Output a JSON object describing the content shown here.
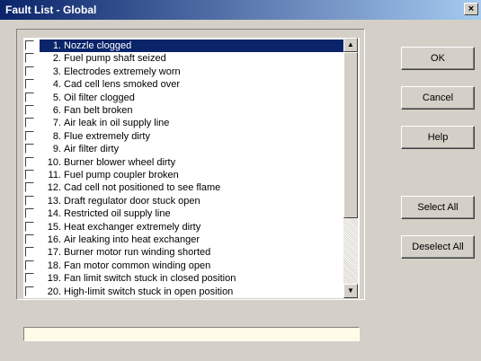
{
  "window": {
    "title": "Fault List - Global",
    "close_label": "×"
  },
  "faults": [
    {
      "num": "1.",
      "label": "Nozzle clogged",
      "selected": true
    },
    {
      "num": "2.",
      "label": "Fuel pump shaft seized"
    },
    {
      "num": "3.",
      "label": "Electrodes extremely worn"
    },
    {
      "num": "4.",
      "label": "Cad cell lens smoked over"
    },
    {
      "num": "5.",
      "label": "Oil filter clogged"
    },
    {
      "num": "6.",
      "label": "Fan belt broken"
    },
    {
      "num": "7.",
      "label": "Air leak in oil supply line"
    },
    {
      "num": "8.",
      "label": "Flue extremely dirty"
    },
    {
      "num": "9.",
      "label": "Air filter dirty"
    },
    {
      "num": "10.",
      "label": "Burner blower wheel dirty"
    },
    {
      "num": "11.",
      "label": "Fuel pump coupler broken"
    },
    {
      "num": "12.",
      "label": "Cad cell not positioned to see flame"
    },
    {
      "num": "13.",
      "label": "Draft regulator door stuck open"
    },
    {
      "num": "14.",
      "label": "Restricted oil supply line"
    },
    {
      "num": "15.",
      "label": "Heat exchanger extremely dirty"
    },
    {
      "num": "16.",
      "label": "Air leaking into heat exchanger"
    },
    {
      "num": "17.",
      "label": "Burner motor run winding shorted"
    },
    {
      "num": "18.",
      "label": "Fan motor common winding open"
    },
    {
      "num": "19.",
      "label": "Fan limit switch stuck in closed position"
    },
    {
      "num": "20.",
      "label": "High-limit switch stuck in open position"
    }
  ],
  "buttons": {
    "ok": "OK",
    "cancel": "Cancel",
    "help": "Help",
    "select_all": "Select All",
    "deselect_all": "Deselect All"
  },
  "status": {
    "text": ""
  },
  "scroll": {
    "up_icon": "▲",
    "down_icon": "▼"
  }
}
